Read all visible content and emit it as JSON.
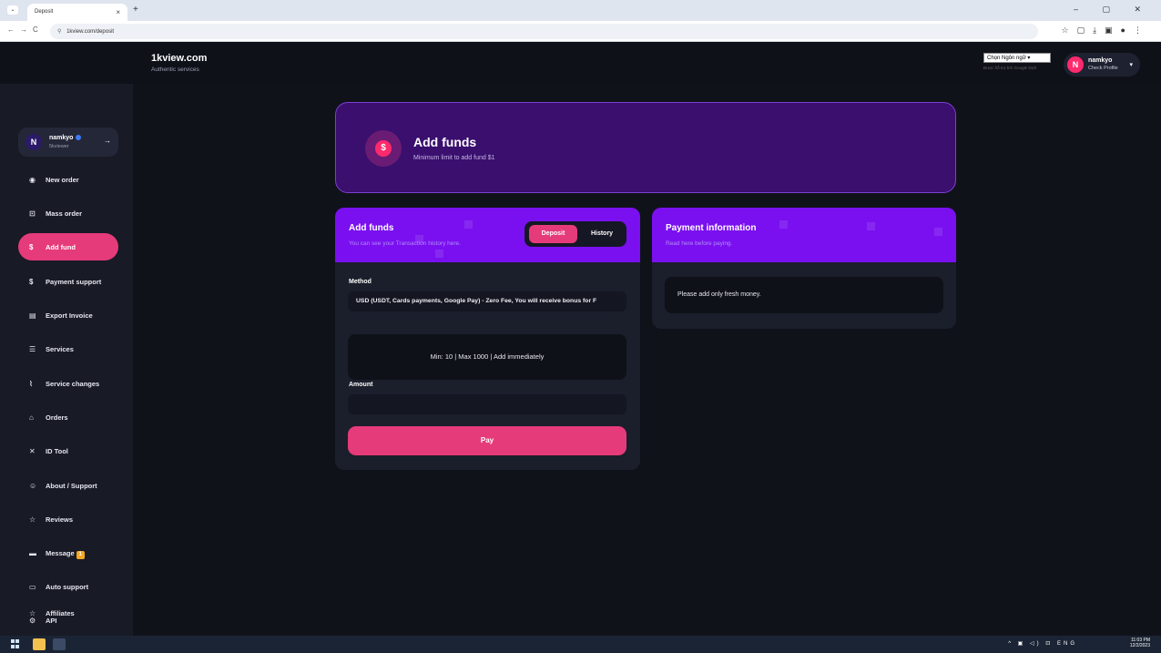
{
  "browser": {
    "tab_title": "Deposit",
    "tab_close": "×",
    "new_tab": "+",
    "url": "1kview.com/deposit",
    "window_controls": "–  ▢  ✕"
  },
  "site": {
    "name": "1kview.com",
    "tagline": "Authentic services"
  },
  "language": {
    "selected": "Chọn Ngôn ngữ",
    "powered": "Được hỗ trợ bởi Google Dịch"
  },
  "user": {
    "initial": "N",
    "name": "namkyo",
    "role": "5kviewer",
    "profile_link": "Check Profile"
  },
  "sidebar": {
    "items": [
      {
        "label": "New order",
        "icon": "◉"
      },
      {
        "label": "Mass order",
        "icon": "⊡"
      },
      {
        "label": "Add fund",
        "icon": "$",
        "active": true
      },
      {
        "label": "Payment support",
        "icon": "$"
      },
      {
        "label": "Export Invoice",
        "icon": "▤"
      },
      {
        "label": "Services",
        "icon": "☰"
      },
      {
        "label": "Service changes",
        "icon": "⌇"
      },
      {
        "label": "Orders",
        "icon": "⌂"
      },
      {
        "label": "ID Tool",
        "icon": "✕"
      },
      {
        "label": "About / Support",
        "icon": "☺"
      },
      {
        "label": "Reviews",
        "icon": "☆"
      },
      {
        "label": "Message",
        "icon": "▬",
        "badge": "1"
      },
      {
        "label": "Auto support",
        "icon": "▭"
      },
      {
        "label": "API",
        "icon": "⚙"
      },
      {
        "label": "Affiliates",
        "icon": "☆"
      }
    ]
  },
  "hero": {
    "title": "Add funds",
    "subtitle": "Minimum limit to add fund $1"
  },
  "add_funds": {
    "title": "Add funds",
    "subtitle": "You can see your Transaction history here.",
    "tab_deposit": "Deposit",
    "tab_history": "History",
    "method_label": "Method",
    "method_value": "USD (USDT, Cards payments, Google Pay) - Zero Fee, You will receive bonus for F",
    "info": "Min: 10 | Max 1000 | Add immediately",
    "amount_label": "Amount",
    "amount_value": "",
    "pay_label": "Pay"
  },
  "payment_info": {
    "title": "Payment information",
    "subtitle": "Read here before paying.",
    "note": "Please add only fresh money."
  },
  "taskbar": {
    "lang": "ENG",
    "time": "11:03 PM",
    "date": "12/2/2023"
  },
  "colors": {
    "accent_pink": "#e63b7a",
    "accent_purple": "#7a10f0",
    "hero_bg": "#3a0f6e"
  }
}
